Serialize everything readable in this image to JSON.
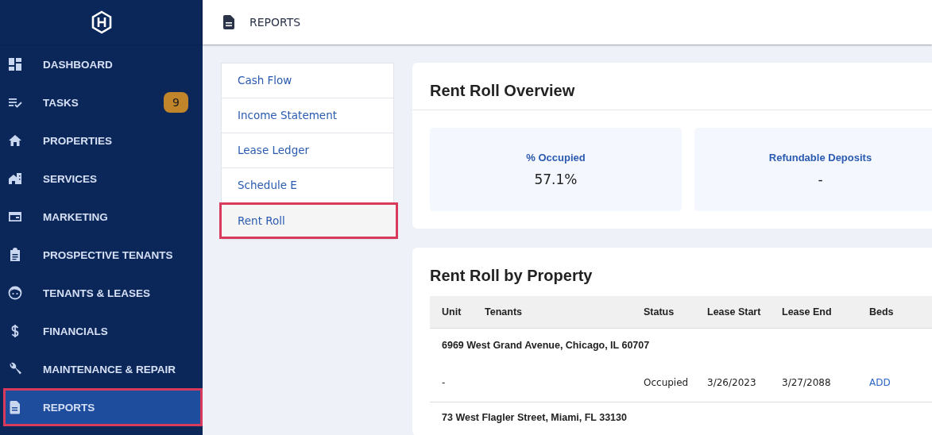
{
  "sidebar": {
    "items": [
      {
        "label": "DASHBOARD",
        "selected": false
      },
      {
        "label": "TASKS",
        "selected": false,
        "badge": "9"
      },
      {
        "label": "PROPERTIES",
        "selected": false
      },
      {
        "label": "SERVICES",
        "selected": false
      },
      {
        "label": "MARKETING",
        "selected": false
      },
      {
        "label": "PROSPECTIVE TENANTS",
        "selected": false
      },
      {
        "label": "TENANTS & LEASES",
        "selected": false
      },
      {
        "label": "FINANCIALS",
        "selected": false
      },
      {
        "label": "MAINTENANCE & REPAIR",
        "selected": false
      },
      {
        "label": "REPORTS",
        "selected": true
      }
    ]
  },
  "header": {
    "title": "REPORTS"
  },
  "report_menu": [
    {
      "label": "Cash Flow",
      "selected": false
    },
    {
      "label": "Income Statement",
      "selected": false
    },
    {
      "label": "Lease Ledger",
      "selected": false
    },
    {
      "label": "Schedule E",
      "selected": false
    },
    {
      "label": "Rent Roll",
      "selected": true
    }
  ],
  "overview": {
    "title": "Rent Roll Overview",
    "stats": [
      {
        "label": "% Occupied",
        "value": "57.1%"
      },
      {
        "label": "Refundable Deposits",
        "value": "-"
      }
    ]
  },
  "by_property": {
    "title": "Rent Roll by Property",
    "columns": [
      "Unit",
      "Tenants",
      "Status",
      "Lease Start",
      "Lease End",
      "Beds"
    ],
    "groups": [
      {
        "address": "6969 West Grand Avenue, Chicago, IL 60707",
        "rows": [
          {
            "unit": "-",
            "status": "Occupied",
            "lease_start": "3/26/2023",
            "lease_end": "3/27/2088",
            "beds": "ADD"
          }
        ]
      },
      {
        "address": "73 West Flagler Street, Miami, FL 33130"
      }
    ]
  }
}
